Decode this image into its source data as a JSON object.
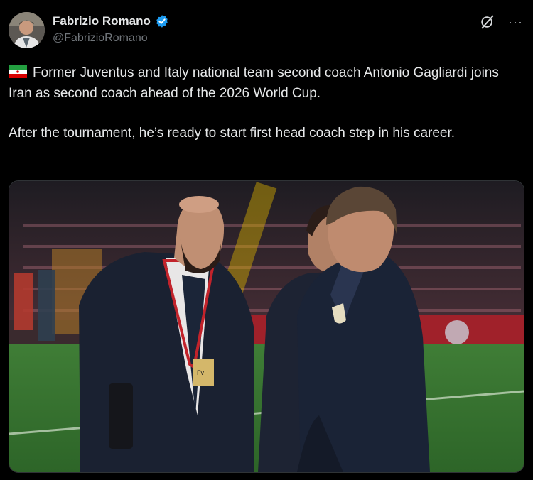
{
  "author": {
    "display_name": "Fabrizio Romano",
    "handle": "@FabrizioRomano",
    "verified": true,
    "accent_color": "#1d9bf0"
  },
  "actions": {
    "grok_icon": "grok-slash-icon",
    "more_icon": "more-horizontal-icon",
    "more_label": "···"
  },
  "tweet": {
    "flag": "Iran flag",
    "paragraph1": "Former Juventus and Italy national team second coach Antonio Gagliardi joins Iran as second coach ahead of the 2026 World Cup.",
    "paragraph2": "After the tournament, he’s ready to start first head coach step in his career."
  },
  "media": {
    "badge_text": "Fv"
  }
}
